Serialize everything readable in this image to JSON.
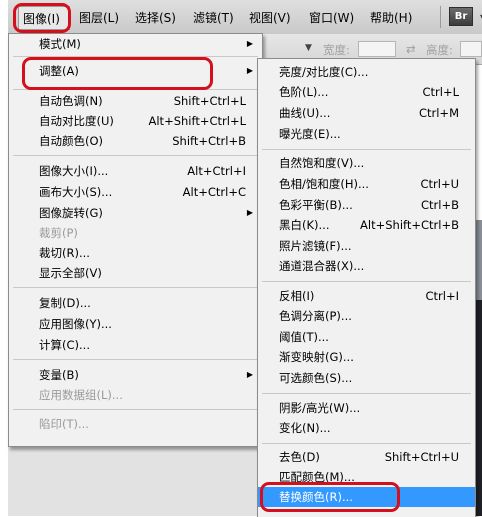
{
  "menubar": {
    "items": [
      "图像(I)",
      "图层(L)",
      "选择(S)",
      "滤镜(T)",
      "视图(V)",
      "窗口(W)",
      "帮助(H)"
    ],
    "br_label": "Br"
  },
  "options": {
    "width_label": "宽度:",
    "height_label": "高度:"
  },
  "main_menu": {
    "mode": {
      "label": "模式(M)"
    },
    "adjust": {
      "label": "调整(A)"
    },
    "auto_tone": {
      "label": "自动色调(N)",
      "shortcut": "Shift+Ctrl+L"
    },
    "auto_contrast": {
      "label": "自动对比度(U)",
      "shortcut": "Alt+Shift+Ctrl+L"
    },
    "auto_color": {
      "label": "自动颜色(O)",
      "shortcut": "Shift+Ctrl+B"
    },
    "image_size": {
      "label": "图像大小(I)...",
      "shortcut": "Alt+Ctrl+I"
    },
    "canvas_size": {
      "label": "画布大小(S)...",
      "shortcut": "Alt+Ctrl+C"
    },
    "image_rotation": {
      "label": "图像旋转(G)"
    },
    "crop": {
      "label": "裁剪(P)"
    },
    "trim": {
      "label": "裁切(R)..."
    },
    "reveal_all": {
      "label": "显示全部(V)"
    },
    "duplicate": {
      "label": "复制(D)..."
    },
    "apply_image": {
      "label": "应用图像(Y)..."
    },
    "calculations": {
      "label": "计算(C)..."
    },
    "variables": {
      "label": "变量(B)"
    },
    "apply_data_set": {
      "label": "应用数据组(L)..."
    },
    "trap": {
      "label": "陷印(T)..."
    }
  },
  "adjust_menu": {
    "brightness_contrast": {
      "label": "亮度/对比度(C)..."
    },
    "levels": {
      "label": "色阶(L)...",
      "shortcut": "Ctrl+L"
    },
    "curves": {
      "label": "曲线(U)...",
      "shortcut": "Ctrl+M"
    },
    "exposure": {
      "label": "曝光度(E)..."
    },
    "vibrance": {
      "label": "自然饱和度(V)..."
    },
    "hue_saturation": {
      "label": "色相/饱和度(H)...",
      "shortcut": "Ctrl+U"
    },
    "color_balance": {
      "label": "色彩平衡(B)...",
      "shortcut": "Ctrl+B"
    },
    "black_white": {
      "label": "黑白(K)...",
      "shortcut": "Alt+Shift+Ctrl+B"
    },
    "photo_filter": {
      "label": "照片滤镜(F)..."
    },
    "channel_mixer": {
      "label": "通道混合器(X)..."
    },
    "invert": {
      "label": "反相(I)",
      "shortcut": "Ctrl+I"
    },
    "posterize": {
      "label": "色调分离(P)..."
    },
    "threshold": {
      "label": "阈值(T)..."
    },
    "gradient_map": {
      "label": "渐变映射(G)..."
    },
    "selective_color": {
      "label": "可选颜色(S)..."
    },
    "shadows_highlights": {
      "label": "阴影/高光(W)..."
    },
    "variations": {
      "label": "变化(N)..."
    },
    "desaturate": {
      "label": "去色(D)",
      "shortcut": "Shift+Ctrl+U"
    },
    "match_color": {
      "label": "匹配颜色(M)..."
    },
    "replace_color": {
      "label": "替换颜色(R)..."
    }
  },
  "colors": {
    "highlight": "#3399ff",
    "annotation_red": "#d4101c",
    "menu_bg": "#f1f1f1"
  }
}
